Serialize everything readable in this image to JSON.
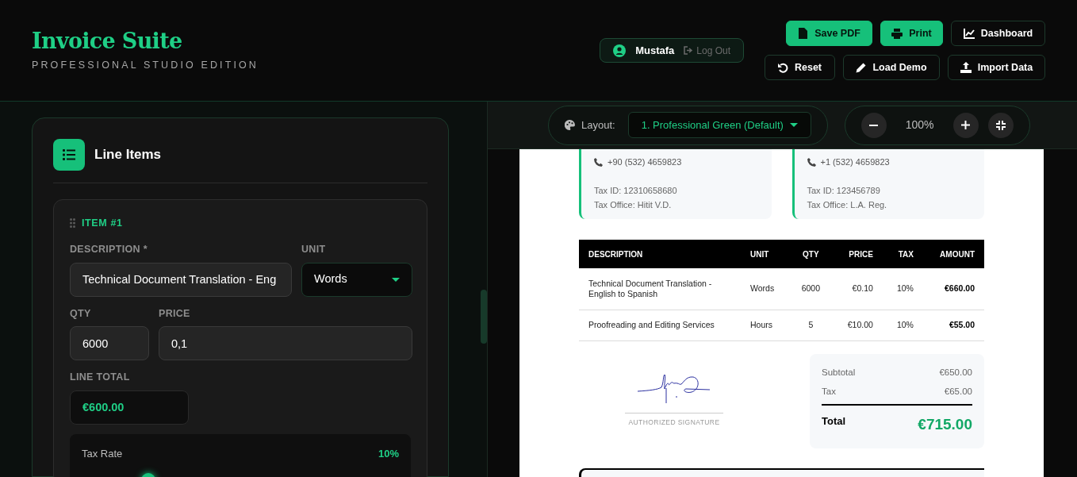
{
  "header": {
    "title": "Invoice Suite",
    "subtitle": "PROFESSIONAL STUDIO EDITION",
    "user": {
      "name": "Mustafa",
      "logout": "Log Out"
    },
    "actions": [
      {
        "label": "Save PDF",
        "kind": "primary"
      },
      {
        "label": "Print",
        "kind": "primary"
      },
      {
        "label": "Dashboard",
        "kind": "outline"
      },
      {
        "label": "Reset",
        "kind": "outline"
      },
      {
        "label": "Load Demo",
        "kind": "outline"
      },
      {
        "label": "Import Data",
        "kind": "outline"
      }
    ]
  },
  "editor": {
    "title": "Line Items",
    "item": {
      "heading": "ITEM #1",
      "description_label": "DESCRIPTION *",
      "description": "Technical Document Translation - Eng",
      "unit_label": "UNIT",
      "unit": "Words",
      "qty_label": "QTY",
      "qty": "6000",
      "price_label": "PRICE",
      "price": "0,1",
      "line_total_label": "LINE TOTAL",
      "line_total": "€600.00",
      "tax_label": "Tax Rate",
      "tax_value": "10%",
      "tax_slider": {
        "level": 0.21
      }
    }
  },
  "toolbar": {
    "layout_label": "Layout:",
    "layout": "1. Professional Green (Default)",
    "zoom": "100%"
  },
  "invoice": {
    "parties": [
      {
        "phone": "+90 (532) 4659823",
        "tax_id": "Tax ID: 12310658680",
        "tax_office": "Tax Office: Hitit V.D."
      },
      {
        "phone": "+1 (532) 4659823",
        "tax_id": "Tax ID: 123456789",
        "tax_office": "Tax Office: L.A. Reg."
      }
    ],
    "table": {
      "columns": [
        "DESCRIPTION",
        "UNIT",
        "QTY",
        "PRICE",
        "TAX",
        "AMOUNT"
      ],
      "rows": [
        [
          "Technical Document Translation - English to Spanish",
          "Words",
          "6000",
          "€0.10",
          "10%",
          "€660.00"
        ],
        [
          "Proofreading and Editing Services",
          "Hours",
          "5",
          "€10.00",
          "10%",
          "€55.00"
        ]
      ]
    },
    "signature_label": "AUTHORIZED SIGNATURE",
    "totals": [
      {
        "label": "Subtotal",
        "value": "€650.00"
      },
      {
        "label": "Tax",
        "value": "€65.00"
      }
    ],
    "total": {
      "label": "Total",
      "value": "€715.00"
    }
  }
}
